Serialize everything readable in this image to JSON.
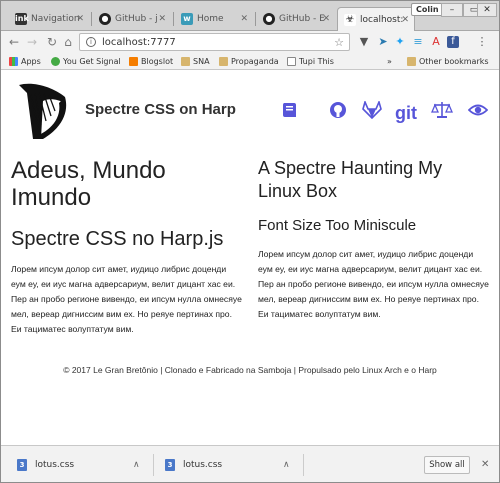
{
  "tabs": [
    {
      "label": "Navigation",
      "icon": "ink-icon",
      "active": false
    },
    {
      "label": "GitHub - j",
      "icon": "github-icon",
      "active": false
    },
    {
      "label": "Home",
      "icon": "home-page-icon",
      "active": false
    },
    {
      "label": "GitHub - E",
      "icon": "github-icon",
      "active": false
    },
    {
      "label": "localhost:",
      "icon": "biohazard-icon",
      "active": true
    }
  ],
  "profile": "Colin",
  "window_controls": {
    "minimize": "–",
    "maximize": "▭",
    "close": "✕"
  },
  "omnibox": {
    "url": "localhost:7777",
    "info_glyph": "i"
  },
  "bookmarks": [
    {
      "label": "Apps",
      "icon": "apps-icon"
    },
    {
      "label": "You Get Signal",
      "icon": "signal-icon"
    },
    {
      "label": "Blogslot",
      "icon": "blogger-icon"
    },
    {
      "label": "SNA",
      "icon": "folder-icon"
    },
    {
      "label": "Propaganda",
      "icon": "folder-icon"
    },
    {
      "label": "Tupi This",
      "icon": "page-icon"
    }
  ],
  "bookmarks_overflow": "»",
  "other_bookmarks": "Other bookmarks",
  "site": {
    "title": "Spectre CSS on Harp",
    "nav_icons": [
      "book-icon",
      "github-icon",
      "gitlab-icon",
      "git-icon",
      "scale-icon",
      "eye-icon"
    ],
    "git_label": "git"
  },
  "left": {
    "heading1": "Adeus, Mundo Imundo",
    "heading2": "Spectre CSS no Harp.js",
    "paragraph": "Лорем ипсум долор сит амет, иудицо либрис доценди еум еу, еи иус магна адверсариум, велит дицант хас еи. Пер ан пробо регионе вивендо, еи ипсум нулла омнесяуе мел, вереар дигниссим вим ех. Но реяуе пертинах про. Еи тациматес волуптатум вим."
  },
  "right": {
    "heading1": "A Spectre Haunting My Linux Box",
    "heading2": "Font Size Too Miniscule",
    "paragraph": "Лорем ипсум долор сит амет, иудицо либрис доценди еум еу, еи иус магна адверсариум, велит дицант хас еи. Пер ан пробо регионе вивендо, еи ипсум нулла омнесяуе мел, вереар дигниссим вим ех. Но реяуе пертинах про. Еи тациматес волуптатум вим."
  },
  "footer": "© 2017 Le Gran Bretônio | Clonado e Fabricado na Samboja | Propulsado pelo Linux Arch e o Harp",
  "downloads": [
    {
      "name": "lotus.css"
    },
    {
      "name": "lotus.css"
    }
  ],
  "show_all": "Show all",
  "colors": {
    "accent": "#5755d9",
    "tabstrip": "#d3d3d3",
    "toolbar": "#f2f2f2"
  }
}
